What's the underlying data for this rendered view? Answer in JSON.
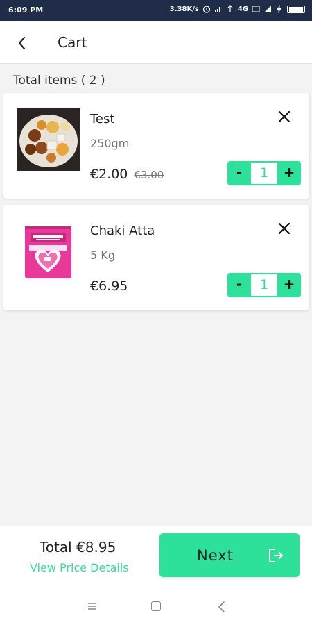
{
  "status_bar": {
    "time": "6:09 PM",
    "speed": "3.38K/s",
    "network": "4G",
    "icons": [
      "alarm-icon",
      "signal-icon",
      "wifi-signal-icon",
      "volte-icon",
      "charging-icon",
      "battery-icon"
    ]
  },
  "header": {
    "back_icon": "chevron-left-icon",
    "title": "Cart"
  },
  "cart": {
    "total_items_label": "Total items ( 2 )",
    "items": [
      {
        "name": "Test",
        "quantity_desc": "250gm",
        "price": "€2.00",
        "old_price": "€3.00",
        "qty": "1",
        "minus_label": "-",
        "plus_label": "+",
        "remove_icon": "close-icon",
        "image": "sweets-platter"
      },
      {
        "name": "Chaki Atta",
        "quantity_desc": "5 Kg",
        "price": "€6.95",
        "old_price": "",
        "qty": "1",
        "minus_label": "-",
        "plus_label": "+",
        "remove_icon": "close-icon",
        "image": "atta-bag"
      }
    ]
  },
  "footer": {
    "total": "Total €8.95",
    "view_details": "View Price Details",
    "next_label": "Next",
    "next_icon": "logout-arrow-icon"
  },
  "nav": {
    "icons": [
      "menu-icon",
      "home-square-icon",
      "back-triangle-icon"
    ]
  },
  "colors": {
    "accent": "#2ee19a",
    "status_bar": "#1f2d49",
    "background": "#f3f3f3"
  }
}
